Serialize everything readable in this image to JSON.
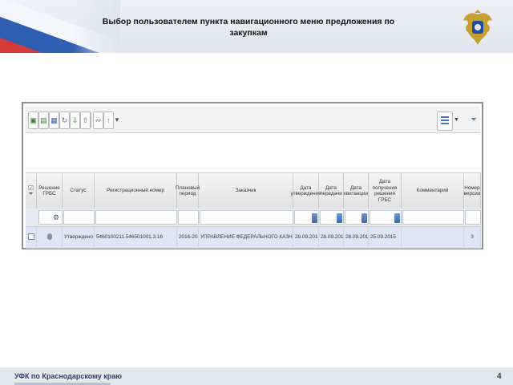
{
  "slide": {
    "title": "Выбор пользователем пункта навигационного меню предложения по закупкам",
    "footer_text": "УФК по Краснодарскому краю",
    "page_number": "4"
  },
  "toolbar": {
    "buttons": [
      "add-document-icon",
      "copy-document-icon",
      "save-icon",
      "refresh-icon",
      "import-icon",
      "export-icon",
      "link-icon",
      "upload-icon",
      "dropdown-arrow-icon"
    ],
    "right": [
      "columns-settings-icon",
      "dropdown-arrow-icon",
      "filter-icon"
    ]
  },
  "grid": {
    "columns": [
      "",
      "Решение ГРБС",
      "Статус",
      "Регистрационный номер",
      "Плановый период",
      "Заказчик",
      "Дата утверждения",
      "Дата передачи",
      "Дата квитанции",
      "Дата получения решения ГРБС",
      "Комментарий",
      "Номер версии"
    ],
    "row": {
      "status": "Утверждено",
      "reg_number": "5460100211.546501001.3.16",
      "period": "2016-2018",
      "customer": "УПРАВЛЕНИЕ ФЕДЕРАЛЬНОГО КАЗНАЧЕЙСТВА П",
      "approved_date": "28.09.2015",
      "sent_date": "28.09.2015",
      "receipt_date": "28.09.2015",
      "grbs_decision_date": "25.09.2015",
      "comment": "",
      "version": "3"
    }
  },
  "colors": {
    "row_selected": "#dce6f5",
    "header_bg": "#e3e3e3",
    "footer_text": "#2b3f66"
  }
}
